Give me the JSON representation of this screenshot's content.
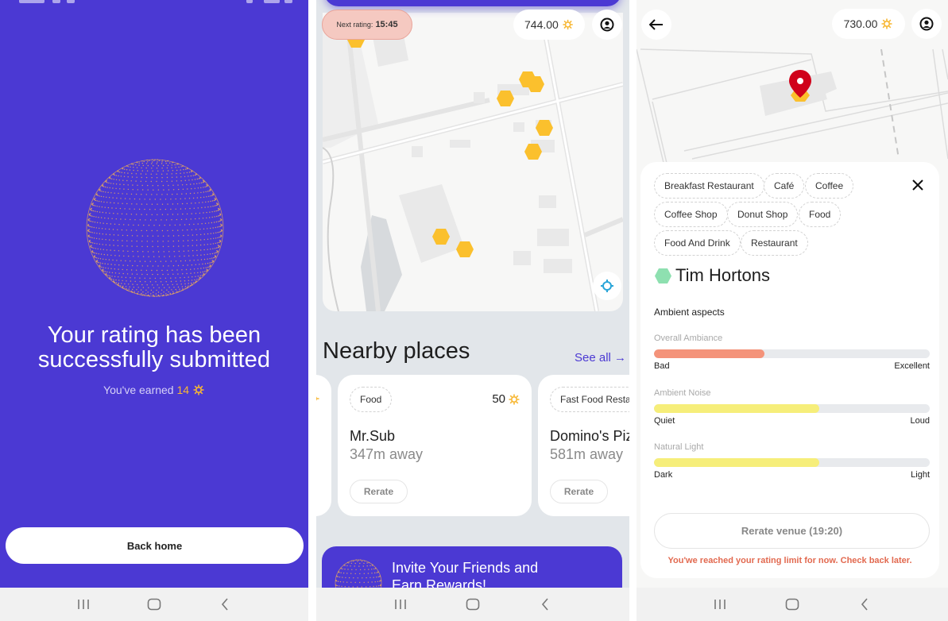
{
  "screens": {
    "success": {
      "title": "Your rating has been successfully submitted",
      "earned_prefix": "You've earned",
      "earned_amount": "14",
      "back_home_label": "Back home"
    },
    "home": {
      "next_rating_label": "Next rating:",
      "next_rating_time": "15:45",
      "balance": "744.00",
      "nearby_title": "Nearby places",
      "see_all_label": "See all →",
      "cards": [
        {
          "category": "Food",
          "name": "Mr.Sub",
          "distance": "347m away",
          "points": "50",
          "rerate_label": "Rerate"
        },
        {
          "category": "Fast Food Restaurant",
          "name": "Domino's Pizza",
          "distance": "581m away",
          "rerate_label": "Rerate"
        }
      ],
      "invite_text": "Invite Your Friends and Earn Rewards!"
    },
    "venue": {
      "balance": "730.00",
      "tags": [
        "Breakfast Restaurant",
        "Café",
        "Coffee",
        "Coffee Shop",
        "Donut Shop",
        "Food",
        "Food And Drink",
        "Restaurant"
      ],
      "name": "Tim Hortons",
      "aspects_title": "Ambient aspects",
      "aspects": [
        {
          "label": "Overall Ambiance",
          "low": "Bad",
          "high": "Excellent",
          "value": 0.4,
          "color": "#f4937a"
        },
        {
          "label": "Ambient Noise",
          "low": "Quiet",
          "high": "Loud",
          "value": 0.6,
          "color": "#f6ee7a"
        },
        {
          "label": "Natural Light",
          "low": "Dark",
          "high": "Light",
          "value": 0.6,
          "color": "#f6ee7a"
        }
      ],
      "rerate_label": "Rerate venue (19:20)",
      "limit_message": "You'we reached your rating limit for now. Check back later."
    }
  },
  "colors": {
    "brand": "#4b39d3",
    "coin": "#f7b733",
    "marker": "#fbc02d",
    "pin": "#d0021b",
    "venue_hex": "#8ee0b0",
    "limit": "#e2694f"
  },
  "nav": {
    "recents": "recents-icon",
    "home": "home-icon",
    "back": "back-icon"
  }
}
